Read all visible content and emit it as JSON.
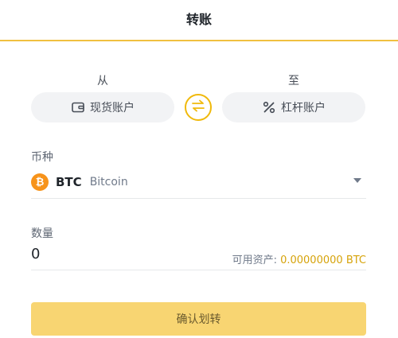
{
  "header": {
    "title": "转账"
  },
  "transfer": {
    "from_label": "从",
    "to_label": "至",
    "from_account": {
      "label": "现货账户",
      "icon": "wallet-icon"
    },
    "to_account": {
      "label": "杠杆账户",
      "icon": "percent-icon"
    },
    "swap_icon": "swap-icon"
  },
  "coin": {
    "label": "币种",
    "symbol": "BTC",
    "name": "Bitcoin",
    "icon_glyph": "₿",
    "icon_color": "#f7931a"
  },
  "amount": {
    "label": "数量",
    "value": "0",
    "available_label": "可用资产:",
    "available_value": "0.00000000",
    "available_unit": "BTC"
  },
  "confirm_button": {
    "label": "确认划转"
  },
  "colors": {
    "accent": "#f0b90b",
    "button_bg": "#f8d572"
  }
}
